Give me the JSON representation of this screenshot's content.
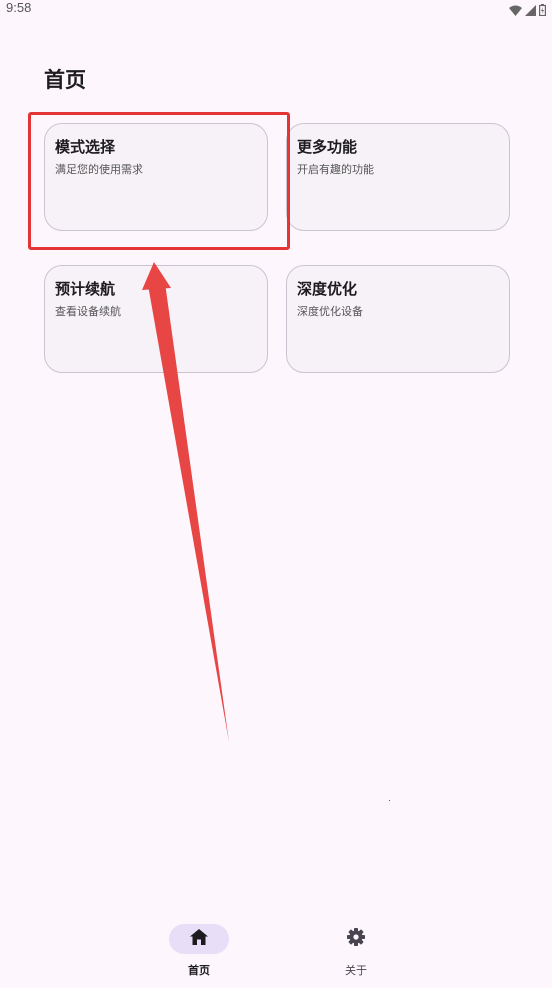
{
  "status_bar": {
    "time": "9:58",
    "icons": [
      "wifi-icon",
      "signal-icon",
      "battery-icon"
    ]
  },
  "page": {
    "title": "首页"
  },
  "cards": [
    {
      "title": "模式选择",
      "description": "满足您的使用需求"
    },
    {
      "title": "更多功能",
      "description": "开启有趣的功能"
    },
    {
      "title": "预计续航",
      "description": "查看设备续航"
    },
    {
      "title": "深度优化",
      "description": "深度优化设备"
    }
  ],
  "bottom_nav": {
    "items": [
      {
        "label": "首页",
        "icon": "home-icon",
        "selected": true
      },
      {
        "label": "关于",
        "icon": "gear-icon",
        "selected": false
      }
    ]
  },
  "annotation": {
    "color": "#e33535"
  },
  "colors": {
    "background": "#fdf7fd",
    "card_background": "#f6f2f7",
    "card_border": "#cac4d0",
    "nav_indicator": "#e8def8"
  }
}
